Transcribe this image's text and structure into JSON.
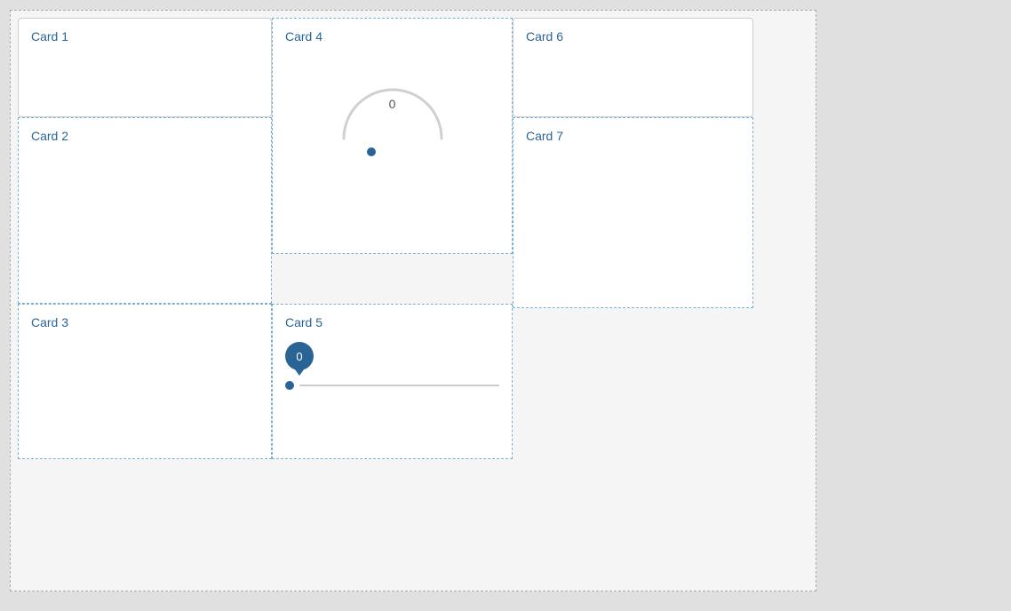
{
  "cards": {
    "card1": {
      "label": "Card 1"
    },
    "card2": {
      "label": "Card 2"
    },
    "card3": {
      "label": "Card 3"
    },
    "card4": {
      "label": "Card 4",
      "gauge_value": "0"
    },
    "card5": {
      "label": "Card 5",
      "slider_value": "0"
    },
    "card6": {
      "label": "Card 6"
    },
    "card7": {
      "label": "Card 7"
    }
  }
}
